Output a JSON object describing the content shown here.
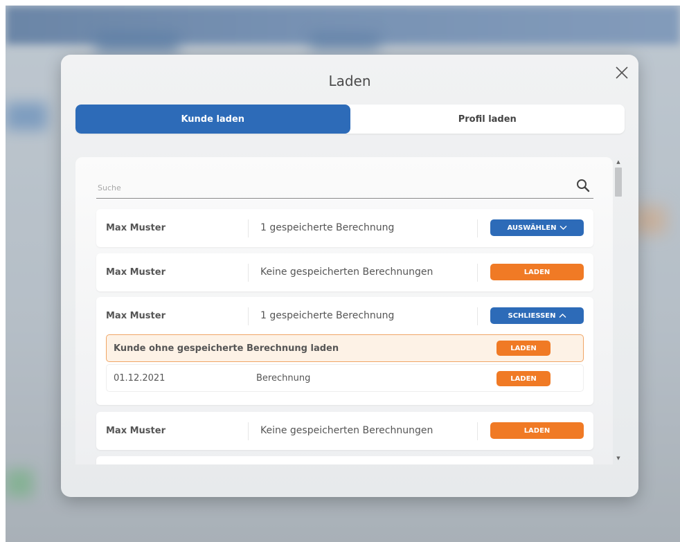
{
  "dialog": {
    "title": "Laden"
  },
  "tabs": [
    {
      "label": "Kunde laden",
      "active": true
    },
    {
      "label": "Profil laden",
      "active": false
    }
  ],
  "search": {
    "placeholder": "Suche",
    "value": ""
  },
  "rows": [
    {
      "name": "Max Muster",
      "info": "1 gespeicherte Berechnung",
      "action": "AUSWÄHLEN",
      "action_icon": "chevron-down-icon",
      "color": "#2d6bb8"
    },
    {
      "name": "Max Muster",
      "info": "Keine gespeicherten Berechnungen",
      "action": "LADEN",
      "color": "#f07a25"
    },
    {
      "name": "Max Muster",
      "info": "1 gespeicherte Berechnung",
      "action": "SCHLIESSEN",
      "action_icon": "chevron-up-icon",
      "color": "#2d6bb8",
      "expanded": {
        "load_without_label": "Kunde ohne gespeicherte Berechnung laden",
        "load_without_action": "LADEN",
        "entries": [
          {
            "date": "01.12.2021",
            "description": "Berechnung",
            "action": "LADEN"
          }
        ]
      }
    },
    {
      "name": "Max Muster",
      "info": "Keine gespeicherten Berechnungen",
      "action": "LADEN",
      "color": "#f07a25"
    }
  ],
  "colors": {
    "primary": "#2d6bb8",
    "accent": "#f07a25",
    "highlight_bg": "#fdf2e6",
    "highlight_border": "#f0a565"
  }
}
